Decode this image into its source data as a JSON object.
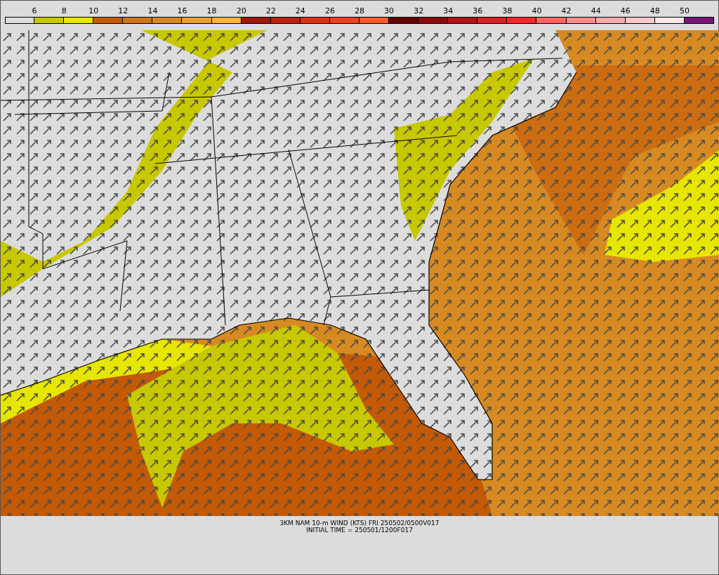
{
  "legend": {
    "swatches": [
      {
        "color": "#dcdcdc"
      },
      {
        "color": "#c8c800"
      },
      {
        "color": "#e6e600"
      },
      {
        "color": "#c45a06"
      },
      {
        "color": "#d07418"
      },
      {
        "color": "#d88a22"
      },
      {
        "color": "#e8a030"
      },
      {
        "color": "#ffb43a"
      },
      {
        "color": "#a0180a"
      },
      {
        "color": "#be200e"
      },
      {
        "color": "#dc3214"
      },
      {
        "color": "#f04020"
      },
      {
        "color": "#ff5a28"
      },
      {
        "color": "#640000"
      },
      {
        "color": "#8c0a0a"
      },
      {
        "color": "#b41414"
      },
      {
        "color": "#d82020"
      },
      {
        "color": "#f82828"
      },
      {
        "color": "#ff6464"
      },
      {
        "color": "#ff8c8c"
      },
      {
        "color": "#ffaaaa"
      },
      {
        "color": "#ffc8c8"
      },
      {
        "color": "#ffe6e6"
      },
      {
        "color": "#781478"
      }
    ],
    "labels": [
      "6",
      "8",
      "10",
      "12",
      "14",
      "16",
      "18",
      "20",
      "22",
      "24",
      "26",
      "28",
      "30",
      "32",
      "34",
      "36",
      "38",
      "40",
      "42",
      "44",
      "46",
      "48",
      "50"
    ]
  },
  "caption": [
    "3KM NAM 10-m WIND (KTS) FRI 250502/0500V017",
    "INITIAL TIME = 250501/1200F017"
  ]
}
